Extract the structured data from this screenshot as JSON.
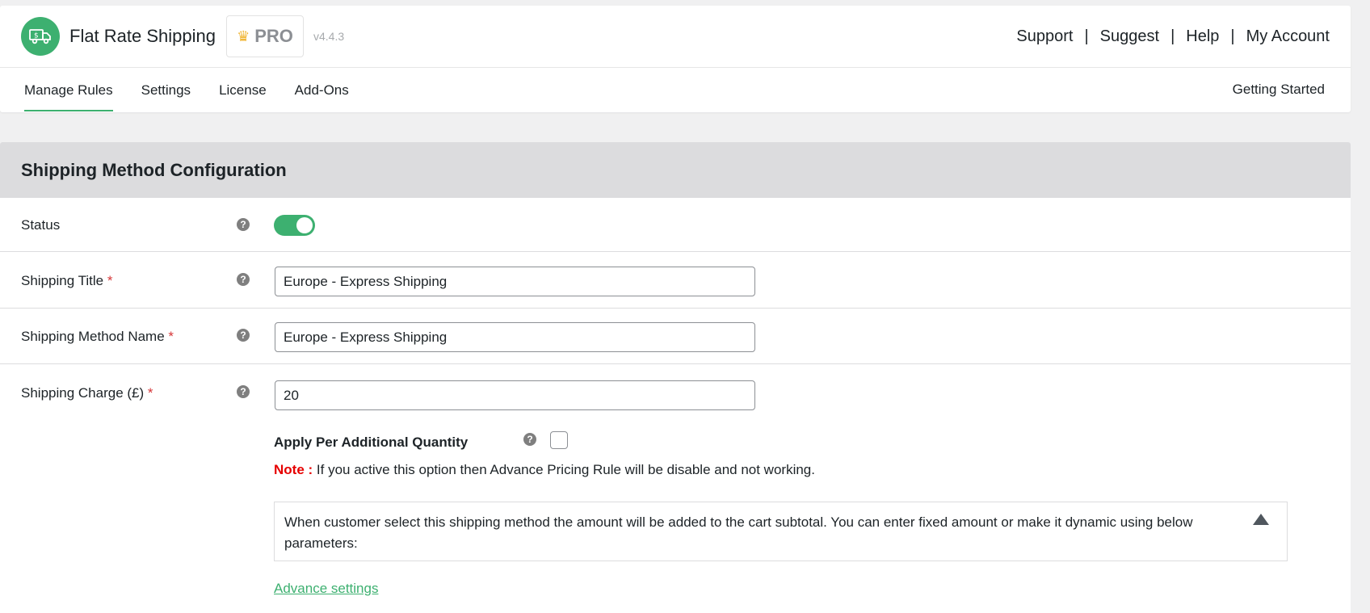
{
  "header": {
    "brand": "Flat Rate Shipping",
    "pro_label": "PRO",
    "version": "v4.4.3",
    "links": [
      "Support",
      "Suggest",
      "Help",
      "My Account"
    ],
    "separator": "|"
  },
  "nav": {
    "tabs": [
      "Manage Rules",
      "Settings",
      "License",
      "Add-Ons"
    ],
    "active_tab": "Manage Rules",
    "right_link": "Getting Started"
  },
  "config": {
    "title": "Shipping Method Configuration",
    "status": {
      "label": "Status",
      "enabled": true
    },
    "shipping_title": {
      "label": "Shipping Title",
      "required_mark": "*",
      "value": "Europe - Express Shipping"
    },
    "method_name": {
      "label": "Shipping Method Name",
      "required_mark": "*",
      "value": "Europe - Express Shipping"
    },
    "charge": {
      "label": "Shipping Charge (£)",
      "required_mark": "*",
      "value": "20",
      "apply_per_qty_label": "Apply Per Additional Quantity",
      "apply_per_qty_checked": false,
      "note_key": "Note :",
      "note_text": "If you active this option then Advance Pricing Rule will be disable and not working.",
      "info_text": "When customer select this shipping method the amount will be added to the cart subtotal. You can enter fixed amount or make it dynamic using below parameters:",
      "advance_link": "Advance settings"
    }
  },
  "colors": {
    "accent": "#3db070",
    "required": "#d63638",
    "note": "#e60000",
    "section_header_bg": "#dcdcde"
  }
}
